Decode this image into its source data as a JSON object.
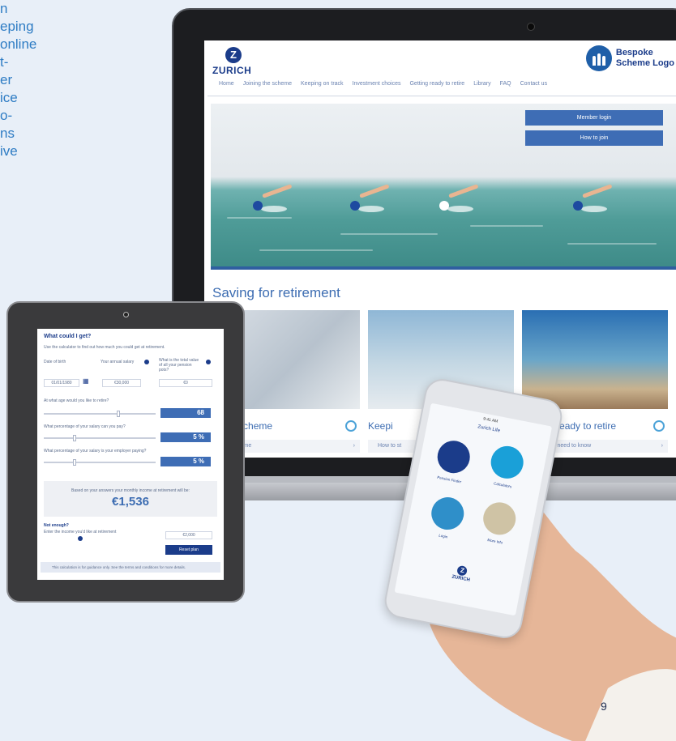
{
  "intro_lines": [
    "n",
    "eping",
    "online",
    "t-",
    "er",
    "ice",
    "o-",
    "ns",
    "ive"
  ],
  "laptop": {
    "site": {
      "brand": "ZURICH",
      "brand_mark": "Z",
      "bespoke_logo_line1": "Bespoke",
      "bespoke_logo_line2": "Scheme Logo",
      "nav": [
        "Home",
        "Joining the scheme",
        "Keeping on track",
        "Investment choices",
        "Getting ready to retire",
        "Library",
        "FAQ",
        "Contact us"
      ],
      "hero_buttons": {
        "member_login": "Member login",
        "how_to_join": "How to join"
      },
      "section_title": "Saving for retirement",
      "cards": [
        {
          "title": "g the scheme",
          "link": "he scheme"
        },
        {
          "title": "Keepi",
          "link": "How to st"
        },
        {
          "title": "Getting ready to retire",
          "link": "What you need to know"
        }
      ]
    }
  },
  "tablet": {
    "title": "What could I get?",
    "intro": "Use the calculator to find out how much you could get at retirement.",
    "date_of_birth_label": "Date of birth",
    "dob_value": "01/01/1980",
    "salary_label": "Your annual salary",
    "salary_value": "€30,000",
    "pot_label": "What is the total value of all your pension pots?",
    "pot_value": "€0",
    "q_retire_age": "At what age would you like to retire?",
    "retire_age_value": "68",
    "q_you_pay": "What percentage of your salary can you pay?",
    "you_pay_value": "5 %",
    "q_employer_pays": "What percentage of your salary is your employer paying?",
    "employer_pays_value": "5 %",
    "result_label": "Based on your answers your monthly income at retirement will be:",
    "result_value": "€1,536",
    "not_enough_label": "Not enough?",
    "not_enough_text": "Enter the income you'd like at retirement",
    "target_value": "€2,000",
    "reset_label": "Reset plan",
    "footer_text": "This calculation is for guidance only. See the terms and conditions for more details."
  },
  "phone": {
    "status": "9:41 AM",
    "title": "Zurich Life",
    "tiles": [
      "Pension Finder",
      "Calculators",
      "Login",
      "More Info"
    ],
    "brand": "ZURICH",
    "brand_mark": "Z"
  },
  "page_number": "9",
  "colors": {
    "brand_blue": "#1b3c8a",
    "accent_blue": "#3e6db5",
    "background": "#e8eff8"
  }
}
